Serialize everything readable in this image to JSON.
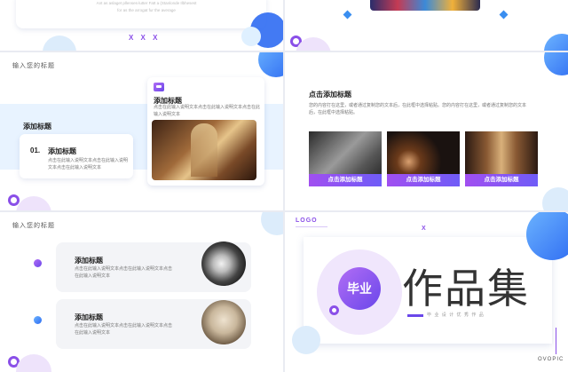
{
  "slide1": {
    "text_line1": "Ant as aslaget pllenses-lutter Fatt a (Stanlonde Ilbhesest",
    "text_line2": "for as the arrogat fur the average",
    "marks": "X X X"
  },
  "slide3": {
    "header": "输入您的标题",
    "left_title": "添加标题",
    "item_number": "01.",
    "item_title": "添加标题",
    "item_body": "点击在此输入说明文本点击在此输入说明文本点击在此输入说明文本",
    "card_title": "添加标题",
    "card_body": "点击在此输入说明文本点击在此输入说明文本点击在此输入说明文本"
  },
  "slide4": {
    "title": "点击添加标题",
    "body": "您的内容打在这里，或者通过复制您的文本后，在此框中选择粘贴。您的内容打在这里，或者通过复制您的文本后，在此框中选择粘贴。",
    "photo_labels": [
      "点击添加标题",
      "点击添加标题",
      "点击添加标题"
    ]
  },
  "slide5": {
    "header": "输入您的标题",
    "items": [
      {
        "title": "添加标题",
        "body": "点击在此输入说明文本点击在此输入说明文本点击在此输入说明文本"
      },
      {
        "title": "添加标题",
        "body": "点击在此输入说明文本点击在此输入说明文本点击在此输入说明文本"
      }
    ]
  },
  "slide6": {
    "logo": "LOGO",
    "mark": "X",
    "badge": "毕业",
    "main_title": "作品集",
    "subtitle": "毕 业 设 计 优 秀 作 品",
    "brand": "OVOPIC"
  },
  "colors": {
    "purple": "#8a4fe8",
    "blue": "#2f6cf2",
    "light_blue": "#dff0ff"
  }
}
